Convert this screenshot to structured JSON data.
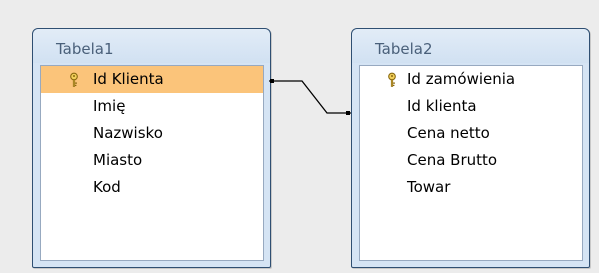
{
  "tables": [
    {
      "title": "Tabela1",
      "fields": [
        {
          "label": "Id Klienta",
          "primary_key": true,
          "selected": true
        },
        {
          "label": "Imię",
          "primary_key": false,
          "selected": false
        },
        {
          "label": "Nazwisko",
          "primary_key": false,
          "selected": false
        },
        {
          "label": "Miasto",
          "primary_key": false,
          "selected": false
        },
        {
          "label": "Kod",
          "primary_key": false,
          "selected": false
        }
      ]
    },
    {
      "title": "Tabela2",
      "fields": [
        {
          "label": "Id zamówienia",
          "primary_key": true,
          "selected": false
        },
        {
          "label": "Id klienta",
          "primary_key": false,
          "selected": false
        },
        {
          "label": "Cena netto",
          "primary_key": false,
          "selected": false
        },
        {
          "label": "Cena Brutto",
          "primary_key": false,
          "selected": false
        },
        {
          "label": "Towar",
          "primary_key": false,
          "selected": false
        }
      ]
    }
  ],
  "relationship": {
    "from": "Tabela1.Id Klienta",
    "to": "Tabela2.Id klienta"
  },
  "icons": {
    "primary_key": "key-icon"
  },
  "colors": {
    "selection": "#fbc47a",
    "title_text": "#4a607a",
    "border": "#2f4f72"
  }
}
